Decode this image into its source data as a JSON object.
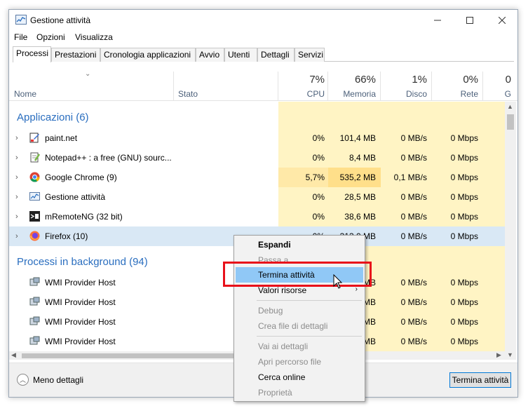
{
  "window": {
    "title": "Gestione attività"
  },
  "menu": [
    "File",
    "Opzioni",
    "Visualizza"
  ],
  "tabs": [
    "Processi",
    "Prestazioni",
    "Cronologia applicazioni",
    "Avvio",
    "Utenti",
    "Dettagli",
    "Servizi"
  ],
  "header": {
    "name": "Nome",
    "status": "Stato",
    "columns": [
      {
        "pct": "7%",
        "label": "CPU"
      },
      {
        "pct": "66%",
        "label": "Memoria"
      },
      {
        "pct": "1%",
        "label": "Disco"
      },
      {
        "pct": "0%",
        "label": "Rete"
      },
      {
        "pct": "0",
        "label": "G"
      }
    ]
  },
  "groups": {
    "apps": "Applicazioni (6)",
    "background": "Processi in background (94)"
  },
  "apps": [
    {
      "name": "paint.net",
      "cpu": "0%",
      "mem": "101,4 MB",
      "disk": "0 MB/s",
      "net": "0 Mbps",
      "icon": "paintnet-icon"
    },
    {
      "name": "Notepad++ : a free (GNU) sourc...",
      "cpu": "0%",
      "mem": "8,4 MB",
      "disk": "0 MB/s",
      "net": "0 Mbps",
      "icon": "notepadpp-icon"
    },
    {
      "name": "Google Chrome (9)",
      "cpu": "5,7%",
      "mem": "535,2 MB",
      "disk": "0,1 MB/s",
      "net": "0 Mbps",
      "icon": "chrome-icon"
    },
    {
      "name": "Gestione attività",
      "cpu": "0%",
      "mem": "28,5 MB",
      "disk": "0 MB/s",
      "net": "0 Mbps",
      "icon": "taskmanager-icon"
    },
    {
      "name": "mRemoteNG (32 bit)",
      "cpu": "0%",
      "mem": "38,6 MB",
      "disk": "0 MB/s",
      "net": "0 Mbps",
      "icon": "mremoteng-icon"
    },
    {
      "name": "Firefox (10)",
      "cpu": "0%",
      "mem": "313,0 MB",
      "disk": "0 MB/s",
      "net": "0 Mbps",
      "icon": "firefox-icon"
    }
  ],
  "background": [
    {
      "name": "WMI Provider Host",
      "mem": "MB",
      "disk": "0 MB/s",
      "net": "0 Mbps"
    },
    {
      "name": "WMI Provider Host",
      "mem": "MB",
      "disk": "0 MB/s",
      "net": "0 Mbps"
    },
    {
      "name": "WMI Provider Host",
      "mem": "MB",
      "disk": "0 MB/s",
      "net": "0 Mbps"
    },
    {
      "name": "WMI Provider Host",
      "mem": "MB",
      "disk": "0 MB/s",
      "net": "0 Mbps"
    }
  ],
  "context_menu": {
    "expand": "Espandi",
    "switch_to": "Passa a",
    "end_task": "Termina attività",
    "resource_values": "Valori risorse",
    "debug": "Debug",
    "create_dump": "Crea file di dettagli",
    "go_to_details": "Vai ai dettagli",
    "open_location": "Apri percorso file",
    "search_online": "Cerca online",
    "properties": "Proprietà"
  },
  "footer": {
    "fewer_details": "Meno dettagli",
    "end_task_button": "Termina attività"
  },
  "colors": {
    "heat_light": "#fff4c4",
    "heat_medium": "#ffe9a8",
    "selection": "#d9e8f5",
    "menu_highlight": "#90c8f6",
    "callout": "#e8101a",
    "group_title": "#2a6ebf"
  }
}
